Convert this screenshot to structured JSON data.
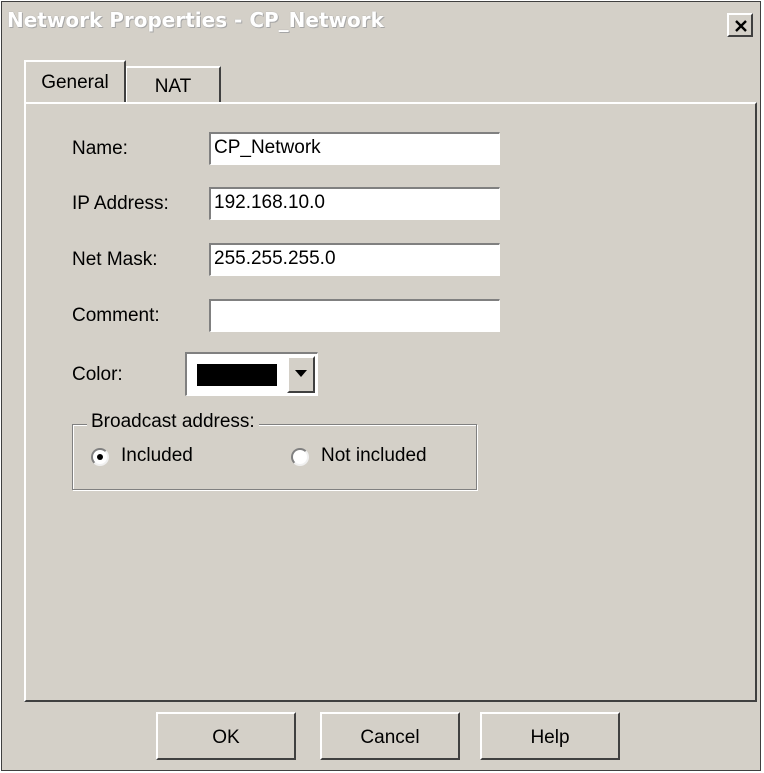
{
  "window": {
    "title": "Network Properties - CP_Network"
  },
  "tabs": [
    {
      "label": "General",
      "selected": true
    },
    {
      "label": "NAT",
      "selected": false
    }
  ],
  "form": {
    "name_label": "Name:",
    "name_value": "CP_Network",
    "ip_label": "IP Address:",
    "ip_value": "192.168.10.0",
    "mask_label": "Net Mask:",
    "mask_value": "255.255.255.0",
    "comment_label": "Comment:",
    "comment_value": "",
    "color_label": "Color:",
    "color_value": "#000000"
  },
  "broadcast": {
    "legend": "Broadcast address:",
    "options": [
      {
        "label": "Included",
        "selected": true
      },
      {
        "label": "Not included",
        "selected": false
      }
    ]
  },
  "buttons": {
    "ok": "OK",
    "cancel": "Cancel",
    "help": "Help"
  },
  "icons": {
    "close": "close-icon",
    "dropdown": "chevron-down-icon"
  }
}
